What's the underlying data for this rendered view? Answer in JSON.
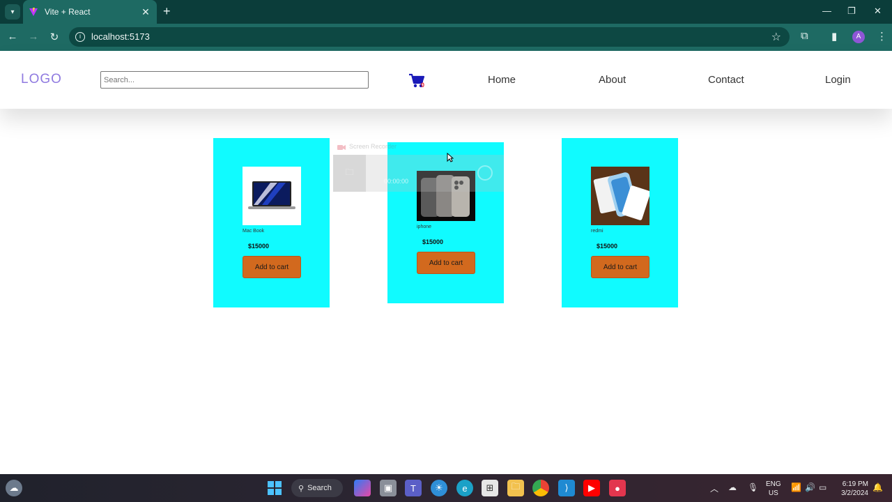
{
  "browser": {
    "tab_title": "Vite + React",
    "url": "localhost:5173",
    "profile_initial": "A"
  },
  "site": {
    "logo": "LOGO",
    "search_placeholder": "Search...",
    "cart_count": "0",
    "nav": [
      "Home",
      "About",
      "Contact",
      "Login"
    ]
  },
  "products": [
    {
      "name": "Mac Book",
      "price": "$15000",
      "button": "Add to cart",
      "image": "laptop"
    },
    {
      "name": "iphone",
      "price": "$15000",
      "button": "Add to cart",
      "image": "phones"
    },
    {
      "name": "redmi",
      "price": "$15000",
      "button": "Add to cart",
      "image": "phone-box"
    }
  ],
  "recorder": {
    "title": "Screen Recorder",
    "time": "00:00:00"
  },
  "taskbar": {
    "search_label": "Search",
    "language": "ENG",
    "region": "US",
    "time": "6:19 PM",
    "date": "3/2/2024"
  },
  "colors": {
    "card_bg": "#10fbff",
    "button_bg": "#d2691e",
    "logo": "#8f7ae0",
    "browser_frame": "#1e6a63"
  }
}
